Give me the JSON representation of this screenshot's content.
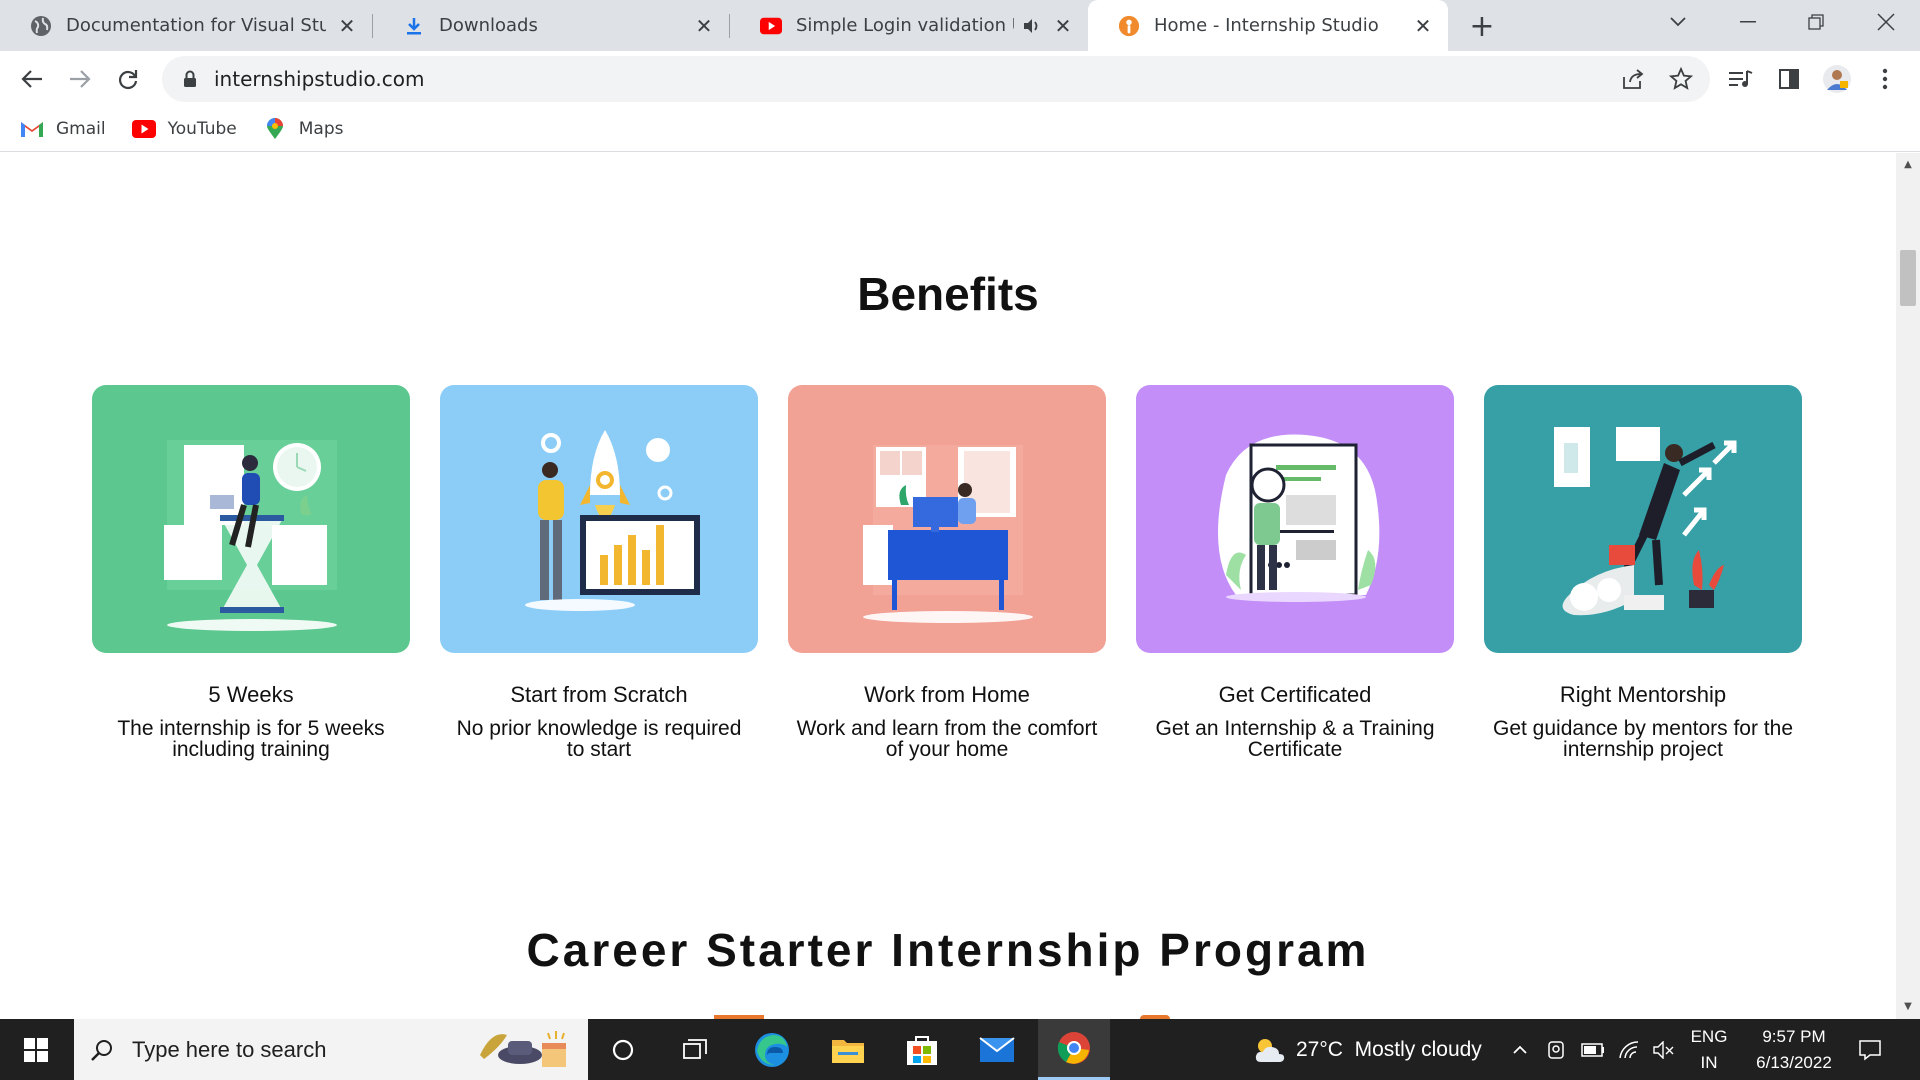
{
  "browser": {
    "tabs": [
      {
        "title": "Documentation for Visual Studio",
        "icon": "globe-icon",
        "active": false
      },
      {
        "title": "Downloads",
        "icon": "download-icon",
        "active": false
      },
      {
        "title": "Simple Login validation Using",
        "icon": "youtube-icon",
        "active": false,
        "audio": true
      },
      {
        "title": "Home - Internship Studio",
        "icon": "internship-studio-icon",
        "active": true
      }
    ],
    "url": "internshipstudio.com",
    "bookmarks": [
      {
        "label": "Gmail",
        "icon": "gmail-icon"
      },
      {
        "label": "YouTube",
        "icon": "youtube-icon"
      },
      {
        "label": "Maps",
        "icon": "maps-icon"
      }
    ]
  },
  "page": {
    "benefits_title": "Benefits",
    "cards": [
      {
        "title": "5 Weeks",
        "description": "The internship is for 5 weeks including training",
        "color": "#5cc88f",
        "illustration": "man-on-hourglass-illustration"
      },
      {
        "title": "Start from Scratch",
        "description": "No prior knowledge is required to start",
        "color": "#8ccdf7",
        "illustration": "rocket-launch-illustration"
      },
      {
        "title": "Work from Home",
        "description": "Work and learn from the comfort of your home",
        "color": "#f2a195",
        "illustration": "desk-work-illustration"
      },
      {
        "title": "Get Certificated",
        "description": "Get an Internship & a Training Certificate",
        "color": "#c38ef8",
        "illustration": "certificate-illustration"
      },
      {
        "title": "Right Mentorship",
        "description": "Get guidance by mentors for the internship project",
        "color": "#36a0a6",
        "illustration": "flying-businessman-illustration"
      }
    ],
    "career_title": "Career Starter Internship Program"
  },
  "taskbar": {
    "search_placeholder": "Type here to search",
    "weather": "27°C  Mostly cloudy",
    "language": "ENG",
    "region": "IN",
    "time": "9:57 PM",
    "date": "6/13/2022"
  }
}
